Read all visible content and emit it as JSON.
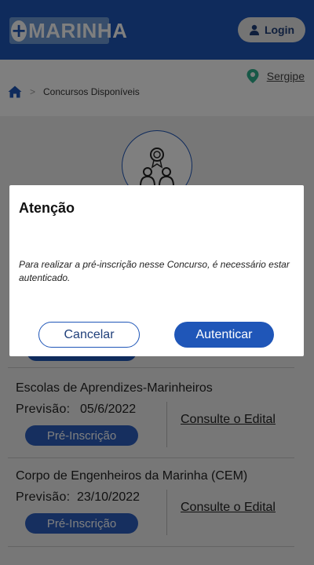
{
  "header": {
    "logo_plus": "+",
    "logo_text": "MARINHA",
    "login_label": "Login"
  },
  "location": {
    "name": "Sergipe"
  },
  "breadcrumb": {
    "separator": ">",
    "current": "Concursos Disponíveis"
  },
  "contests": [
    {
      "title": "Escolas de Aprendizes-Marinheiros",
      "forecast_label": "Previsão:",
      "forecast_date": "05/6/2022",
      "pre_button": "Pré-Inscrição",
      "edital_link": "Consulte o Edital"
    },
    {
      "title": "Corpo de Engenheiros da Marinha (CEM)",
      "forecast_label": "Previsão:",
      "forecast_date": "23/10/2022",
      "pre_button": "Pré-Inscrição",
      "edital_link": "Consulte o Edital"
    }
  ],
  "modal": {
    "title": "Atenção",
    "message": "Para realizar a pré-inscrição nesse Concurso, é necessário estar autenticado.",
    "cancel_label": "Cancelar",
    "auth_label": "Autenticar"
  },
  "colors": {
    "primary": "#1f56b8",
    "location_pin": "#2fb08f",
    "overlay": "rgba(0,0,0,0.5)"
  },
  "icons": {
    "logo": "plus-circle-icon",
    "login": "user-icon",
    "location": "map-pin-icon",
    "home": "home-icon",
    "hero": "people-award-icon"
  }
}
